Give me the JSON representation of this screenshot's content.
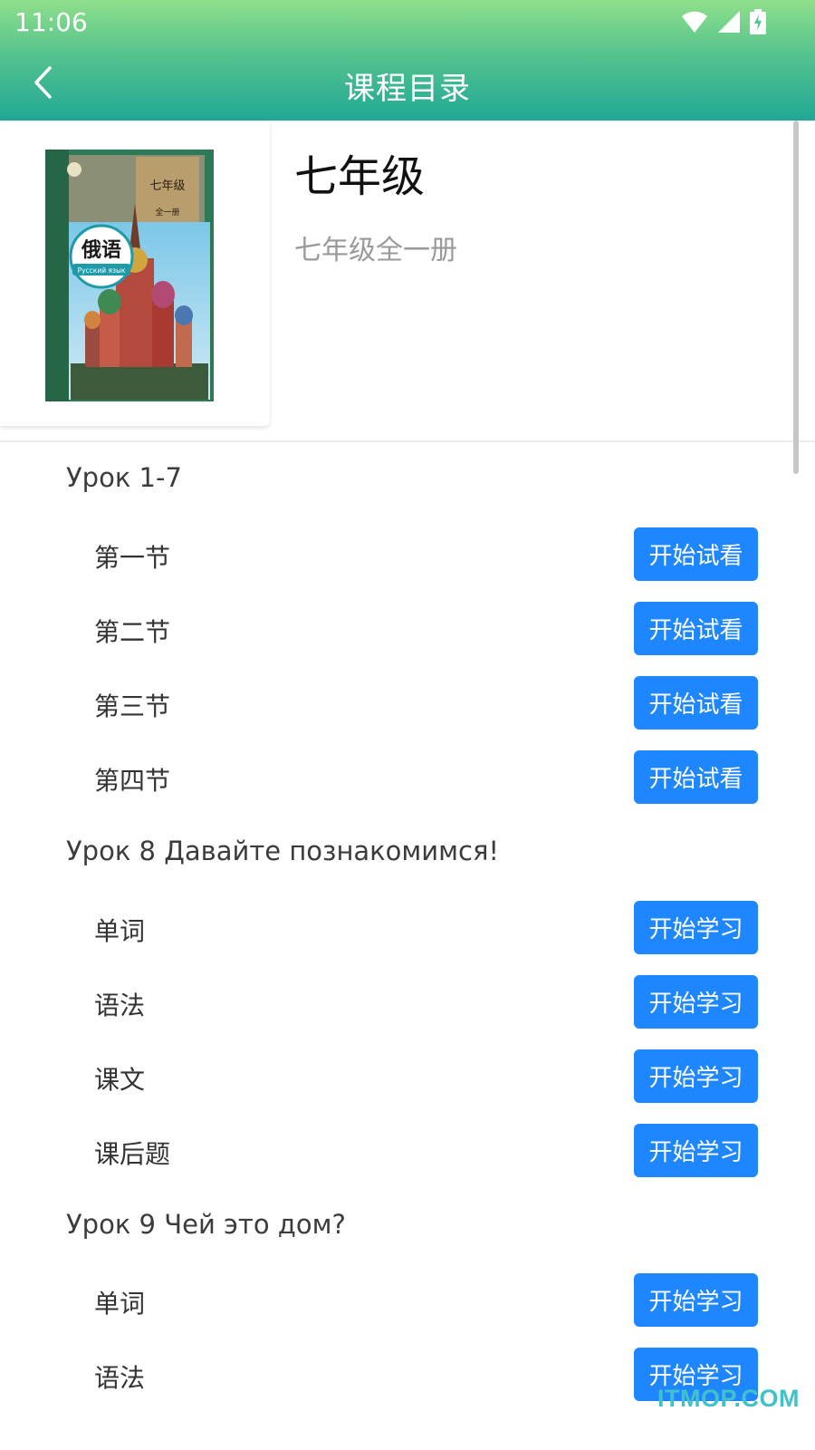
{
  "status_bar": {
    "time": "11:06"
  },
  "appbar": {
    "title": "课程目录"
  },
  "course": {
    "title": "七年级",
    "subtitle": "七年级全一册",
    "cover": {
      "grade": "七年级",
      "volume": "全一册",
      "subject": "俄语",
      "subject_ru": "Русский язык"
    }
  },
  "units": [
    {
      "title": "Урок 1-7",
      "lessons": [
        {
          "label": "第一节",
          "button": "开始试看"
        },
        {
          "label": "第二节",
          "button": "开始试看"
        },
        {
          "label": "第三节",
          "button": "开始试看"
        },
        {
          "label": "第四节",
          "button": "开始试看"
        }
      ]
    },
    {
      "title": "Урок 8 Давайте познакомимся!",
      "lessons": [
        {
          "label": "单词",
          "button": "开始学习"
        },
        {
          "label": "语法",
          "button": "开始学习"
        },
        {
          "label": "课文",
          "button": "开始学习"
        },
        {
          "label": "课后题",
          "button": "开始学习"
        }
      ]
    },
    {
      "title": "Урок 9 Чей это дом?",
      "lessons": [
        {
          "label": "单词",
          "button": "开始学习"
        },
        {
          "label": "语法",
          "button": "开始学习"
        }
      ]
    }
  ],
  "watermark": "ITMOP.COM",
  "icons": {
    "back": "chevron-left-icon",
    "wifi": "wifi-icon",
    "signal": "cell-signal-icon",
    "battery": "battery-charging-icon"
  },
  "colors": {
    "appbar_top": "#8fe08a",
    "appbar_bottom": "#20a896",
    "button": "#1e86ff",
    "watermark": "#40c2c8"
  }
}
